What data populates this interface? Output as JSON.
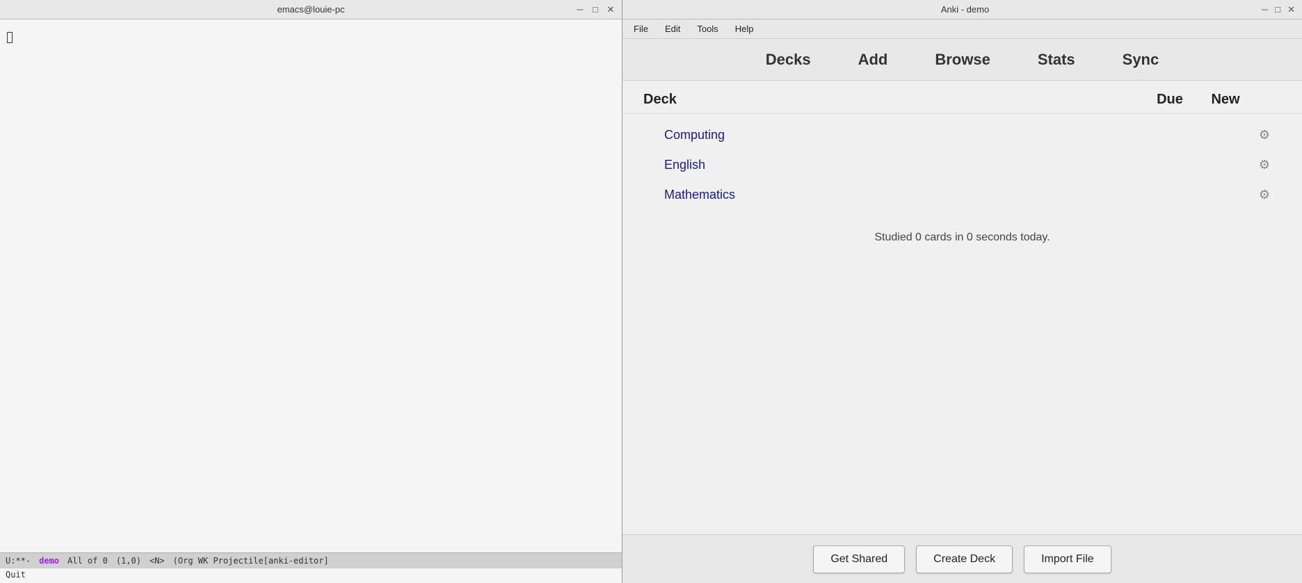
{
  "emacs": {
    "title": "emacs@louie-pc",
    "win_controls": [
      "─",
      "□",
      "✕"
    ],
    "statusbar": {
      "mode": "U:**-",
      "buffer": "demo",
      "position": "All of 0",
      "coords": "(1,0)",
      "mode_name": "<N>",
      "minor_modes": "(Org WK Projectile[anki-editor]"
    },
    "minibuffer": "Quit"
  },
  "anki": {
    "title": "Anki - demo",
    "win_controls": [
      "─",
      "□",
      "✕"
    ],
    "menu": {
      "items": [
        "File",
        "Edit",
        "Tools",
        "Help"
      ]
    },
    "toolbar": {
      "buttons": [
        "Decks",
        "Add",
        "Browse",
        "Stats",
        "Sync"
      ]
    },
    "deck_table": {
      "headers": {
        "deck": "Deck",
        "due": "Due",
        "new": "New"
      },
      "rows": [
        {
          "name": "Computing",
          "due": "",
          "new": ""
        },
        {
          "name": "English",
          "due": "",
          "new": ""
        },
        {
          "name": "Mathematics",
          "due": "",
          "new": ""
        }
      ]
    },
    "studied_text": "Studied 0 cards in 0 seconds today.",
    "footer": {
      "buttons": [
        "Get Shared",
        "Create Deck",
        "Import File"
      ]
    }
  }
}
